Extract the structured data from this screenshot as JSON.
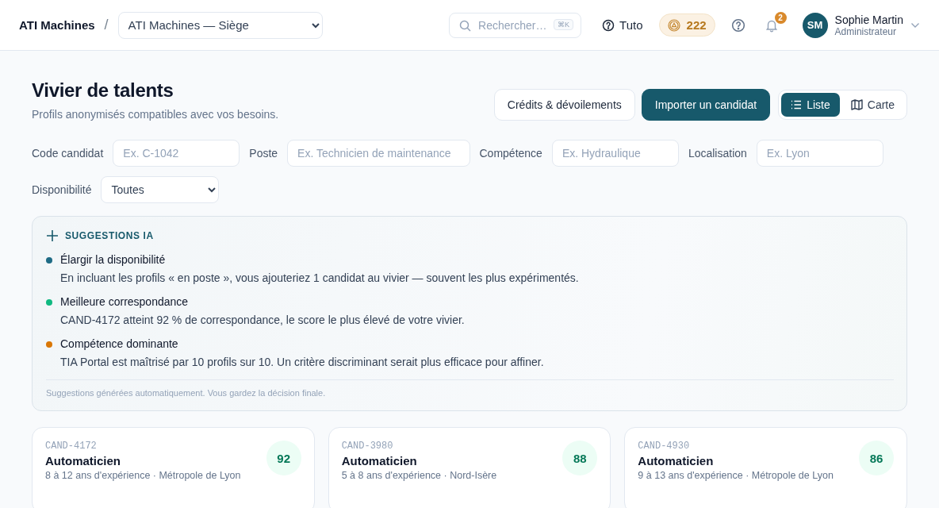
{
  "header": {
    "brand": "ATI Machines",
    "separator": "/",
    "org_select": "ATI Machines — Siège",
    "search": {
      "placeholder": "Rechercher…",
      "shortcut": "⌘K"
    },
    "tuto": "Tuto",
    "credits": "222",
    "notifications": "2",
    "user": {
      "initials": "SM",
      "name": "Sophie Martin",
      "role": "Administrateur"
    }
  },
  "page": {
    "title": "Vivier de talents",
    "subtitle": "Profils anonymisés compatibles avec vos besoins."
  },
  "actions": [
    {
      "label": "Crédits & dévoilements",
      "kind": "secondary"
    },
    {
      "label": "Importer un candidat",
      "kind": "primary"
    }
  ],
  "view_toggle": [
    {
      "label": "Liste",
      "kind": "list",
      "selected": true
    },
    {
      "label": "Carte",
      "kind": "map",
      "selected": false
    }
  ],
  "filters": [
    {
      "label": "Code candidat",
      "placeholder": "Ex. C-1042",
      "kind": "input"
    },
    {
      "label": "Poste",
      "placeholder": "Ex. Technicien de maintenance",
      "kind": "input"
    },
    {
      "label": "Compétence",
      "placeholder": "Ex. Hydraulique",
      "kind": "input"
    },
    {
      "label": "Localisation",
      "placeholder": "Ex. Lyon",
      "kind": "input"
    },
    {
      "label": "Disponibilité",
      "value": "Toutes",
      "kind": "select"
    }
  ],
  "suggestions": {
    "title": "SUGGESTIONS IA",
    "items": [
      {
        "title": "Élargir la disponibilité",
        "text": "En incluant les profils « en poste », vous ajouteriez 1 candidat au vivier — souvent les plus expérimentés.",
        "color": "#1e6b85"
      },
      {
        "title": "Meilleure correspondance",
        "text": "CAND-4172 atteint 92 % de correspondance, le score le plus élevé de votre vivier.",
        "color": "#10b981"
      },
      {
        "title": "Compétence dominante",
        "text": "TIA Portal est maîtrisé par 10 profils sur 10. Un critère discriminant serait plus efficace pour affiner.",
        "color": "#d97706"
      }
    ],
    "footnote": "Suggestions générées automatiquement. Vous gardez la décision finale."
  },
  "cards": [
    {
      "code": "CAND-4172",
      "title": "Automaticien",
      "meta": "8 à 12 ans d'expérience · Métropole de Lyon",
      "score": "92"
    },
    {
      "code": "CAND-3980",
      "title": "Automaticien",
      "meta": "5 à 8 ans d'expérience · Nord-Isère",
      "score": "88"
    },
    {
      "code": "CAND-4930",
      "title": "Automaticien",
      "meta": "9 à 13 ans d'expérience · Métropole de Lyon",
      "score": "86"
    }
  ]
}
